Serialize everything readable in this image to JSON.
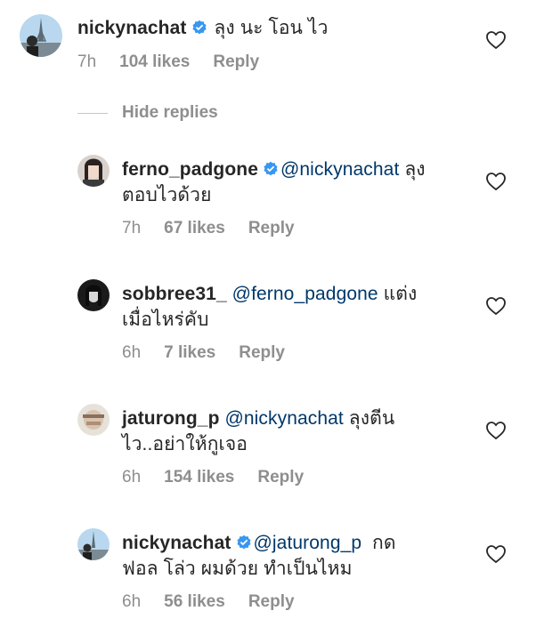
{
  "root_comment": {
    "username": "nickynachat",
    "verified": true,
    "text": " ลุง นะ โอน ไว",
    "time": "7h",
    "likes": "104 likes",
    "reply_label": "Reply"
  },
  "hide_replies_label": "Hide replies",
  "replies": [
    {
      "username": "ferno_padgone",
      "verified": true,
      "mention": "@nickynachat",
      "text_line1": " ลุง",
      "text_line2": "ตอบไวด้วย",
      "time": "7h",
      "likes": "67 likes",
      "reply_label": "Reply"
    },
    {
      "username": "sobbree31_",
      "verified": false,
      "mention": "@ferno_padgone",
      "text_line1": " แต่ง",
      "text_line2": "เมื่อไหร่คับ",
      "time": "6h",
      "likes": "7 likes",
      "reply_label": "Reply"
    },
    {
      "username": "jaturong_p",
      "verified": false,
      "mention": "@nickynachat",
      "text_line1": " ลุงตีน",
      "text_line2": "ไว..อย่าให้กูเจอ",
      "time": "6h",
      "likes": "154 likes",
      "reply_label": "Reply"
    },
    {
      "username": "nickynachat",
      "verified": true,
      "mention": "@jaturong_p",
      "text_line1": "  กด",
      "text_line2": "ฟอล โล่ว ผมด้วย ทำเป็นไหม",
      "time": "6h",
      "likes": "56 likes",
      "reply_label": "Reply"
    }
  ],
  "colors": {
    "text": "#262626",
    "muted": "#8e8e8e",
    "mention": "#00376b",
    "verified_badge": "#3897f0"
  },
  "icons": {
    "like": "heart-outline-icon",
    "verified": "verified-badge-icon"
  }
}
